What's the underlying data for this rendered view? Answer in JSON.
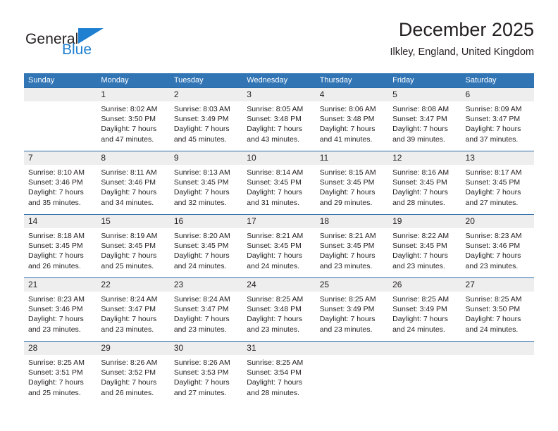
{
  "logo": {
    "word1": "General",
    "word2": "Blue",
    "triangle_color": "#1f7fd0",
    "blue_color": "#1f7fd0"
  },
  "header": {
    "title": "December 2025",
    "location": "Ilkley, England, United Kingdom"
  },
  "theme": {
    "header_blue": "#3175b5",
    "separator_blue": "#2a6ca8",
    "daynum_band": "#eeeeee"
  },
  "weekday_headers": [
    "Sunday",
    "Monday",
    "Tuesday",
    "Wednesday",
    "Thursday",
    "Friday",
    "Saturday"
  ],
  "weeks": [
    {
      "days": [
        {
          "num": "",
          "l1": "",
          "l2": "",
          "l3": "",
          "l4": ""
        },
        {
          "num": "1",
          "l1": "Sunrise: 8:02 AM",
          "l2": "Sunset: 3:50 PM",
          "l3": "Daylight: 7 hours",
          "l4": "and 47 minutes."
        },
        {
          "num": "2",
          "l1": "Sunrise: 8:03 AM",
          "l2": "Sunset: 3:49 PM",
          "l3": "Daylight: 7 hours",
          "l4": "and 45 minutes."
        },
        {
          "num": "3",
          "l1": "Sunrise: 8:05 AM",
          "l2": "Sunset: 3:48 PM",
          "l3": "Daylight: 7 hours",
          "l4": "and 43 minutes."
        },
        {
          "num": "4",
          "l1": "Sunrise: 8:06 AM",
          "l2": "Sunset: 3:48 PM",
          "l3": "Daylight: 7 hours",
          "l4": "and 41 minutes."
        },
        {
          "num": "5",
          "l1": "Sunrise: 8:08 AM",
          "l2": "Sunset: 3:47 PM",
          "l3": "Daylight: 7 hours",
          "l4": "and 39 minutes."
        },
        {
          "num": "6",
          "l1": "Sunrise: 8:09 AM",
          "l2": "Sunset: 3:47 PM",
          "l3": "Daylight: 7 hours",
          "l4": "and 37 minutes."
        }
      ]
    },
    {
      "days": [
        {
          "num": "7",
          "l1": "Sunrise: 8:10 AM",
          "l2": "Sunset: 3:46 PM",
          "l3": "Daylight: 7 hours",
          "l4": "and 35 minutes."
        },
        {
          "num": "8",
          "l1": "Sunrise: 8:11 AM",
          "l2": "Sunset: 3:46 PM",
          "l3": "Daylight: 7 hours",
          "l4": "and 34 minutes."
        },
        {
          "num": "9",
          "l1": "Sunrise: 8:13 AM",
          "l2": "Sunset: 3:45 PM",
          "l3": "Daylight: 7 hours",
          "l4": "and 32 minutes."
        },
        {
          "num": "10",
          "l1": "Sunrise: 8:14 AM",
          "l2": "Sunset: 3:45 PM",
          "l3": "Daylight: 7 hours",
          "l4": "and 31 minutes."
        },
        {
          "num": "11",
          "l1": "Sunrise: 8:15 AM",
          "l2": "Sunset: 3:45 PM",
          "l3": "Daylight: 7 hours",
          "l4": "and 29 minutes."
        },
        {
          "num": "12",
          "l1": "Sunrise: 8:16 AM",
          "l2": "Sunset: 3:45 PM",
          "l3": "Daylight: 7 hours",
          "l4": "and 28 minutes."
        },
        {
          "num": "13",
          "l1": "Sunrise: 8:17 AM",
          "l2": "Sunset: 3:45 PM",
          "l3": "Daylight: 7 hours",
          "l4": "and 27 minutes."
        }
      ]
    },
    {
      "days": [
        {
          "num": "14",
          "l1": "Sunrise: 8:18 AM",
          "l2": "Sunset: 3:45 PM",
          "l3": "Daylight: 7 hours",
          "l4": "and 26 minutes."
        },
        {
          "num": "15",
          "l1": "Sunrise: 8:19 AM",
          "l2": "Sunset: 3:45 PM",
          "l3": "Daylight: 7 hours",
          "l4": "and 25 minutes."
        },
        {
          "num": "16",
          "l1": "Sunrise: 8:20 AM",
          "l2": "Sunset: 3:45 PM",
          "l3": "Daylight: 7 hours",
          "l4": "and 24 minutes."
        },
        {
          "num": "17",
          "l1": "Sunrise: 8:21 AM",
          "l2": "Sunset: 3:45 PM",
          "l3": "Daylight: 7 hours",
          "l4": "and 24 minutes."
        },
        {
          "num": "18",
          "l1": "Sunrise: 8:21 AM",
          "l2": "Sunset: 3:45 PM",
          "l3": "Daylight: 7 hours",
          "l4": "and 23 minutes."
        },
        {
          "num": "19",
          "l1": "Sunrise: 8:22 AM",
          "l2": "Sunset: 3:45 PM",
          "l3": "Daylight: 7 hours",
          "l4": "and 23 minutes."
        },
        {
          "num": "20",
          "l1": "Sunrise: 8:23 AM",
          "l2": "Sunset: 3:46 PM",
          "l3": "Daylight: 7 hours",
          "l4": "and 23 minutes."
        }
      ]
    },
    {
      "days": [
        {
          "num": "21",
          "l1": "Sunrise: 8:23 AM",
          "l2": "Sunset: 3:46 PM",
          "l3": "Daylight: 7 hours",
          "l4": "and 23 minutes."
        },
        {
          "num": "22",
          "l1": "Sunrise: 8:24 AM",
          "l2": "Sunset: 3:47 PM",
          "l3": "Daylight: 7 hours",
          "l4": "and 23 minutes."
        },
        {
          "num": "23",
          "l1": "Sunrise: 8:24 AM",
          "l2": "Sunset: 3:47 PM",
          "l3": "Daylight: 7 hours",
          "l4": "and 23 minutes."
        },
        {
          "num": "24",
          "l1": "Sunrise: 8:25 AM",
          "l2": "Sunset: 3:48 PM",
          "l3": "Daylight: 7 hours",
          "l4": "and 23 minutes."
        },
        {
          "num": "25",
          "l1": "Sunrise: 8:25 AM",
          "l2": "Sunset: 3:49 PM",
          "l3": "Daylight: 7 hours",
          "l4": "and 23 minutes."
        },
        {
          "num": "26",
          "l1": "Sunrise: 8:25 AM",
          "l2": "Sunset: 3:49 PM",
          "l3": "Daylight: 7 hours",
          "l4": "and 24 minutes."
        },
        {
          "num": "27",
          "l1": "Sunrise: 8:25 AM",
          "l2": "Sunset: 3:50 PM",
          "l3": "Daylight: 7 hours",
          "l4": "and 24 minutes."
        }
      ]
    },
    {
      "days": [
        {
          "num": "28",
          "l1": "Sunrise: 8:25 AM",
          "l2": "Sunset: 3:51 PM",
          "l3": "Daylight: 7 hours",
          "l4": "and 25 minutes."
        },
        {
          "num": "29",
          "l1": "Sunrise: 8:26 AM",
          "l2": "Sunset: 3:52 PM",
          "l3": "Daylight: 7 hours",
          "l4": "and 26 minutes."
        },
        {
          "num": "30",
          "l1": "Sunrise: 8:26 AM",
          "l2": "Sunset: 3:53 PM",
          "l3": "Daylight: 7 hours",
          "l4": "and 27 minutes."
        },
        {
          "num": "31",
          "l1": "Sunrise: 8:25 AM",
          "l2": "Sunset: 3:54 PM",
          "l3": "Daylight: 7 hours",
          "l4": "and 28 minutes."
        },
        {
          "num": "",
          "l1": "",
          "l2": "",
          "l3": "",
          "l4": ""
        },
        {
          "num": "",
          "l1": "",
          "l2": "",
          "l3": "",
          "l4": ""
        },
        {
          "num": "",
          "l1": "",
          "l2": "",
          "l3": "",
          "l4": ""
        }
      ]
    }
  ]
}
